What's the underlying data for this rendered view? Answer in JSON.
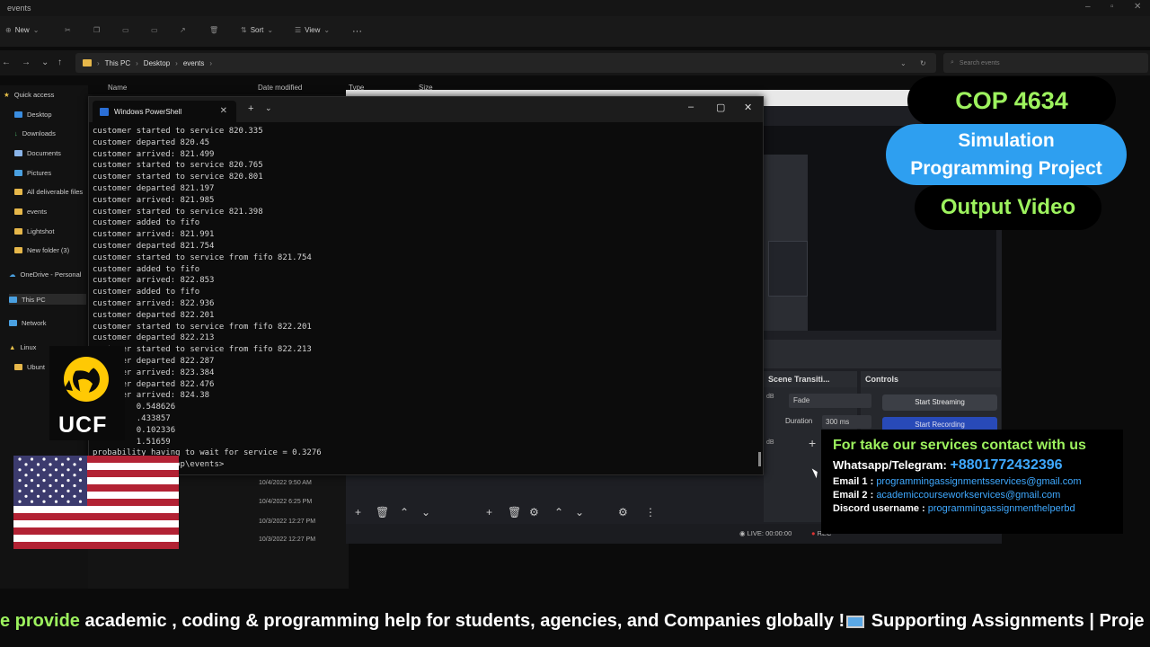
{
  "explorer": {
    "title": "events",
    "toolbar": {
      "new": "New",
      "sort": "Sort",
      "view": "View",
      "more": "···"
    },
    "breadcrumb": [
      "This PC",
      "Desktop",
      "events"
    ],
    "search_placeholder": "Search events",
    "columns": [
      "Name",
      "Date modified",
      "Type",
      "Size"
    ],
    "sidebar": [
      "Quick access",
      "Desktop",
      "Downloads",
      "Documents",
      "Pictures",
      "All deliverable files",
      "events",
      "Lightshot",
      "New folder (3)",
      "OneDrive - Personal",
      "This PC",
      "Network",
      "Linux",
      "Ubunt"
    ],
    "dates": [
      "10/4/2022 9:50 AM",
      "10/4/2022 6:25 PM",
      "10/3/2022 12:27 PM",
      "10/3/2022 12:27 PM"
    ]
  },
  "powershell": {
    "tab_title": "Windows PowerShell",
    "lines": [
      "customer started to service 820.335",
      "customer departed 820.45",
      "customer arrived: 821.499",
      "customer started to service 820.765",
      "customer started to service 820.801",
      "customer departed 821.197",
      "customer arrived: 821.985",
      "customer started to service 821.398",
      "customer added to fifo",
      "customer arrived: 821.991",
      "customer departed 821.754",
      "customer started to service from fifo 821.754",
      "customer added to fifo",
      "customer arrived: 822.853",
      "customer added to fifo",
      "customer arrived: 822.936",
      "customer departed 822.201",
      "customer started to service from fifo 822.201",
      "customer departed 822.213",
      "customer started to service from fifo 822.213",
      "customer departed 822.287",
      "customer arrived: 823.384",
      "customer departed 822.476",
      "customer arrived: 824.38",
      "         0.548626",
      "         .433857",
      "         0.102336",
      "         1.51659",
      "probability having to wait for service = 0.3276",
      "          y\\Desktop\\events>"
    ]
  },
  "obs": {
    "scene_transitions_title": "Scene Transiti...",
    "controls_title": "Controls",
    "transition": "Fade",
    "duration_label": "Duration",
    "duration_value": "300 ms",
    "start_streaming": "Start Streaming",
    "start_recording": "Start Recording",
    "live": "LIVE: 00:00:00",
    "rec": "REC",
    "db1": "dB",
    "db2": "dB"
  },
  "overlay": {
    "course": "COP 4634",
    "project_line1": "Simulation",
    "project_line2": "Programming Project",
    "output": "Output Video",
    "ucf": "UCF",
    "contact_heading": "For take our services contact with us",
    "whatsapp_label": "Whatsapp/Telegram:",
    "whatsapp_value": "+8801772432396",
    "email1_label": "Email 1 :",
    "email1_value": "programmingassignmentsservices@gmail.com",
    "email2_label": "Email 2 :",
    "email2_value": "academiccourseworkservices@gmail.com",
    "discord_label": "Discord username :",
    "discord_value": "programmingassignmenthelperbd",
    "ticker_highlight": "e provide",
    "ticker_text": " academic , coding & programming  help for students, agencies, and Companies  globally !",
    "ticker_text2": " Supporting  Assignments  |  Proje"
  },
  "colors": {
    "accent_green": "#9df25e",
    "accent_blue": "#2e9ff0",
    "link_blue": "#3fa9ff"
  }
}
